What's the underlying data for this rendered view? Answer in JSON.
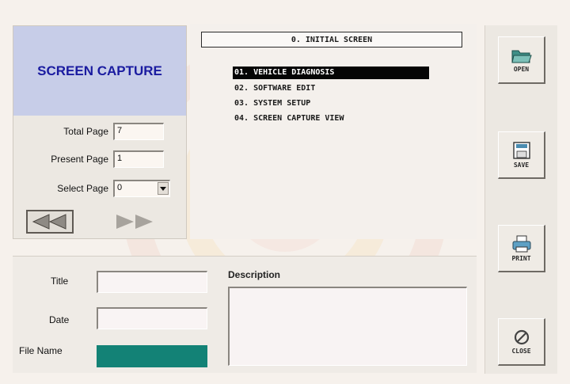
{
  "capture": {
    "heading": "SCREEN CAPTURE",
    "total_page_label": "Total Page",
    "total_page_value": "7",
    "present_page_label": "Present Page",
    "present_page_value": "1",
    "select_page_label": "Select Page",
    "select_page_value": "0",
    "prev_icon": "rewind-icon",
    "next_icon": "fast-forward-icon"
  },
  "screen": {
    "header": "0. INITIAL SCREEN",
    "menu": [
      {
        "label": "01. VEHICLE DIAGNOSIS",
        "selected": true
      },
      {
        "label": "02. SOFTWARE EDIT",
        "selected": false
      },
      {
        "label": "03. SYSTEM SETUP",
        "selected": false
      },
      {
        "label": "04. SCREEN CAPTURE VIEW",
        "selected": false
      }
    ]
  },
  "buttons": {
    "open": "OPEN",
    "save": "SAVE",
    "print": "PRINT",
    "close": "CLOSE"
  },
  "file_info": {
    "title_label": "Title",
    "title_value": "",
    "date_label": "Date",
    "date_value": "",
    "filename_label": "File Name",
    "filename_value": "",
    "description_label": "Description",
    "description_value": ""
  },
  "colors": {
    "heading_text": "#1a1ba0",
    "heading_bg": "#c7cde8",
    "filename_fill": "#138276",
    "menu_selected_bg": "#050505"
  }
}
